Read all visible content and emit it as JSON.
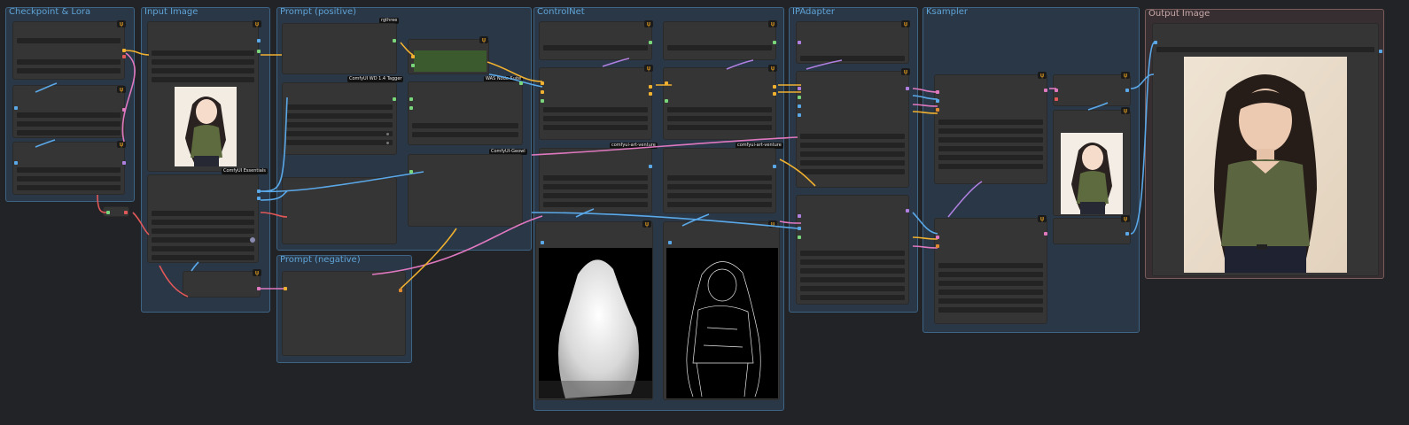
{
  "groups": {
    "checkpoint": "Checkpoint & Lora",
    "input": "Input Image",
    "prompt_pos": "Prompt (positive)",
    "prompt_neg": "Prompt (negative)",
    "controlnet": "ControlNet",
    "ipadapter": "IPAdapter",
    "ksampler": "Ksampler",
    "output": "Output Image"
  },
  "tags": {
    "rgthree": "rgthree",
    "wd14": "ComfyUI WD 1.4 Tagger",
    "was": "WAS Node Suite",
    "essentials": "ComfyUI Essentials",
    "geowl": "ComfyUI-Geowl",
    "art1": "comfyui-art-venture",
    "art2": "comfyui-art-venture"
  },
  "badge_symbol": "ψ",
  "colors": {
    "canvas": "#222326",
    "group_blue": "#3d6485",
    "group_output": "#7a5c5c",
    "title_blue": "#5fa3d6",
    "wire_yellow": "#f0b030",
    "wire_pink": "#e078c0",
    "wire_blue": "#5aa8e8",
    "wire_red": "#e05858",
    "wire_purple": "#b080e0",
    "node_green": "#3b5a2e"
  }
}
